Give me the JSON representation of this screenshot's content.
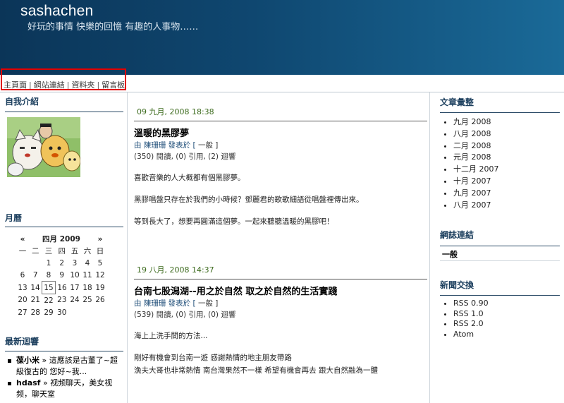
{
  "site": {
    "title": "sashachen",
    "tagline": "好玩的事情 快樂的回憶 有趣的人事物……"
  },
  "nav": {
    "items": [
      "主頁面",
      "網站連結",
      "資料夾",
      "留言板"
    ]
  },
  "left": {
    "about_title": "自我介紹",
    "calendar_title": "月曆",
    "calendar": {
      "prev": "«",
      "month_label": "四月 2009",
      "next": "»",
      "weekdays": [
        "一",
        "二",
        "三",
        "四",
        "五",
        "六",
        "日"
      ],
      "weeks": [
        [
          "",
          "",
          "1",
          "2",
          "3",
          "4",
          "5"
        ],
        [
          "6",
          "7",
          "8",
          "9",
          "10",
          "11",
          "12"
        ],
        [
          "13",
          "14",
          "15",
          "16",
          "17",
          "18",
          "19"
        ],
        [
          "20",
          "21",
          "22",
          "23",
          "24",
          "25",
          "26"
        ],
        [
          "27",
          "28",
          "29",
          "30",
          "",
          "",
          ""
        ]
      ],
      "today": "15"
    },
    "messages_title": "最新迴響",
    "messages": [
      {
        "who": "葆小米",
        "sep": " » ",
        "text": "這應該是古董了~超級復古的 您好~我..."
      },
      {
        "who": "hdasf",
        "sep": " » ",
        "text": "视频聊天，美女视频，聊天室"
      }
    ]
  },
  "posts": [
    {
      "date": "09 九月, 2008 18:38",
      "title": "溫暖的黑膠夢",
      "meta_by": "由 陳珊珊 發表於 [",
      "meta_cat": " 一般 ",
      "meta_end": "]",
      "stats": "(350) 閱讀, (0) 引用, (2) 迴響",
      "body": [
        "喜歡音樂的人大概都有個黑膠夢。",
        "黑膠唱盤只存在於我們的小時候？鄧麗君的歌歌細語從唱盤裡傳出來。",
        "等到長大了，想要再圓滿這個夢。一起來聽聽溫暖的黑膠吧！"
      ]
    },
    {
      "date": "19 八月, 2008 14:37",
      "title": "台南七股潟湖--用之於自然 取之於自然的生活實踐",
      "meta_by": "由 陳珊珊 發表於 [",
      "meta_cat": " 一般 ",
      "meta_end": "]",
      "stats": "(539) 閱讀, (0) 引用, (0) 迴響",
      "body": [
        "海上上洗手間的方法...",
        "剛好有機會到台南一遊 感謝熱情的地主朋友帶路",
        "漁夫大哥也非常熱情 南台灣果然不一樣 希望有機會再去 跟大自然融為一體"
      ]
    }
  ],
  "right": {
    "archive_title": "文章彙整",
    "archive": [
      "九月 2008",
      "八月 2008",
      "二月 2008",
      "元月 2008",
      "十二月 2007",
      "十月 2007",
      "九月 2007",
      "八月 2007"
    ],
    "links_title": "網誌連結",
    "links_item": "一般",
    "news_title": "新聞交換",
    "news": [
      "RSS 0.90",
      "RSS 1.0",
      "RSS 2.0",
      "Atom"
    ]
  },
  "colors": {
    "header_dark": "#0b3558",
    "header_light": "#1a6a98",
    "highlight_box": "#e00000",
    "section_title": "#1c3f5e",
    "post_date": "#3d6b1e"
  }
}
